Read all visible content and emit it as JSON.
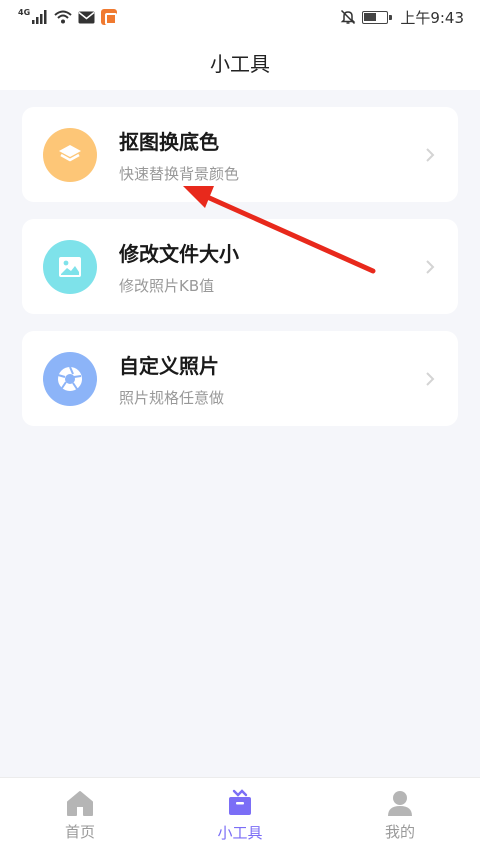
{
  "status_bar": {
    "network": "4G",
    "time": "上午9:43"
  },
  "header": {
    "title": "小工具"
  },
  "tools": [
    {
      "title": "抠图换底色",
      "subtitle": "快速替换背景颜色",
      "icon": "layers-icon",
      "color": "#fdc677"
    },
    {
      "title": "修改文件大小",
      "subtitle": "修改照片KB值",
      "icon": "image-icon",
      "color": "#7ee2ea"
    },
    {
      "title": "自定义照片",
      "subtitle": "照片规格任意做",
      "icon": "aperture-icon",
      "color": "#8cb4f8"
    }
  ],
  "tabbar": {
    "items": [
      {
        "label": "首页",
        "icon": "home-icon"
      },
      {
        "label": "小工具",
        "icon": "toolbox-icon",
        "active": true
      },
      {
        "label": "我的",
        "icon": "user-icon"
      }
    ],
    "active_color": "#7b6ef6",
    "inactive_color": "#b5b5b5"
  },
  "annotation": {
    "arrow_color": "#e8291c"
  }
}
